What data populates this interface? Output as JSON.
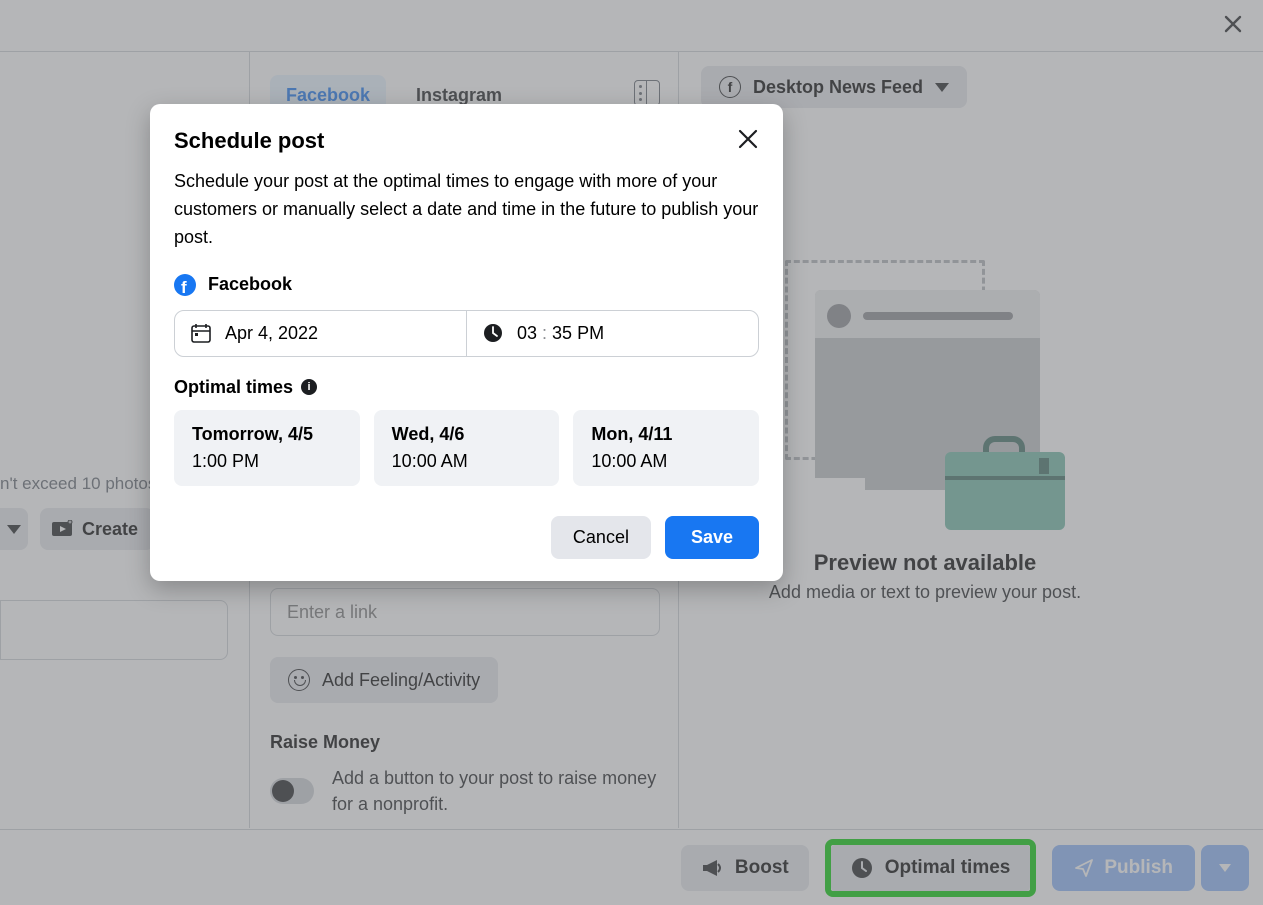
{
  "tabs": {
    "facebook": "Facebook",
    "instagram": "Instagram"
  },
  "feed_select": "Desktop News Feed",
  "side": {
    "photo_limit_note": "n't exceed 10 photos.",
    "create_label": "Create"
  },
  "composer": {
    "link_placeholder": "Enter a link",
    "feeling_label": "Add Feeling/Activity",
    "raise_header": "Raise Money",
    "raise_desc": "Add a button to your post to raise money for a nonprofit."
  },
  "preview": {
    "title": "Preview not available",
    "sub": "Add media or text to preview your post."
  },
  "footer": {
    "boost": "Boost",
    "optimal": "Optimal times",
    "publish": "Publish"
  },
  "modal": {
    "title": "Schedule post",
    "desc": "Schedule your post at the optimal times to engage with more of your customers or manually select a date and time in the future to publish your post.",
    "platform": "Facebook",
    "date": "Apr 4, 2022",
    "time_h": "03",
    "time_m": "35",
    "time_suffix": " PM",
    "optimal_header": "Optimal times",
    "options": [
      {
        "day": "Tomorrow, 4/5",
        "time": "1:00 PM"
      },
      {
        "day": "Wed, 4/6",
        "time": "10:00 AM"
      },
      {
        "day": "Mon, 4/11",
        "time": "10:00 AM"
      }
    ],
    "cancel": "Cancel",
    "save": "Save"
  }
}
